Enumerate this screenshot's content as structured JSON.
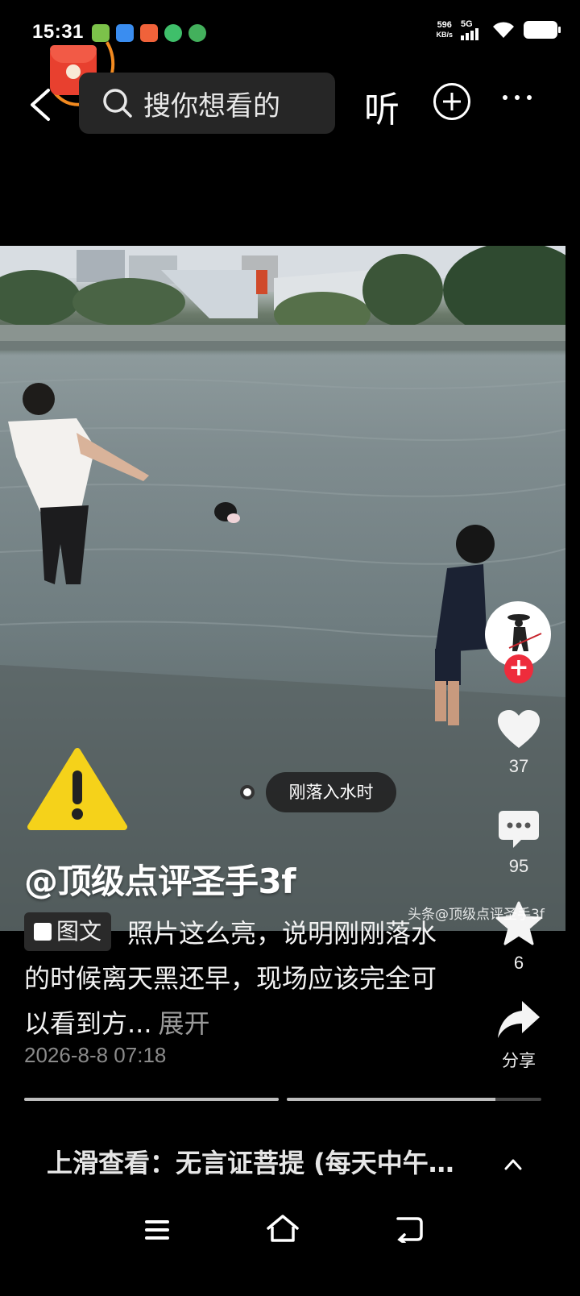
{
  "status_bar": {
    "time": "15:31",
    "net_speed_value": "596",
    "net_speed_unit": "KB/s",
    "network": "5G",
    "notification_icons": [
      "phone-manager-icon",
      "browser-icon",
      "app-store-icon",
      "wechat-icon",
      "chrome-icon"
    ]
  },
  "top_bar": {
    "search_placeholder": "搜你想看的",
    "listen_label": "听"
  },
  "post": {
    "tag_label": "刚落入水时",
    "author": "@顶级点评圣手3f",
    "type_chip": "图文",
    "description": "照片这么亮，说明刚刚落水的时候离天黑还早，现场应该完全可以看到方...",
    "expand_label": "展开",
    "date": "2026-8-8 07:18",
    "watermark": "头条@顶级点评圣手3f"
  },
  "rail": {
    "likes": "37",
    "comments": "95",
    "favorites": "6",
    "share_label": "分享"
  },
  "progress": {
    "segments": [
      1.0,
      0.82
    ]
  },
  "next": {
    "hint": "上滑查看：无言证菩提 (每天中午…"
  },
  "colors": {
    "accent_red": "#ee2c3c",
    "warning_yellow": "#f5d21a"
  }
}
